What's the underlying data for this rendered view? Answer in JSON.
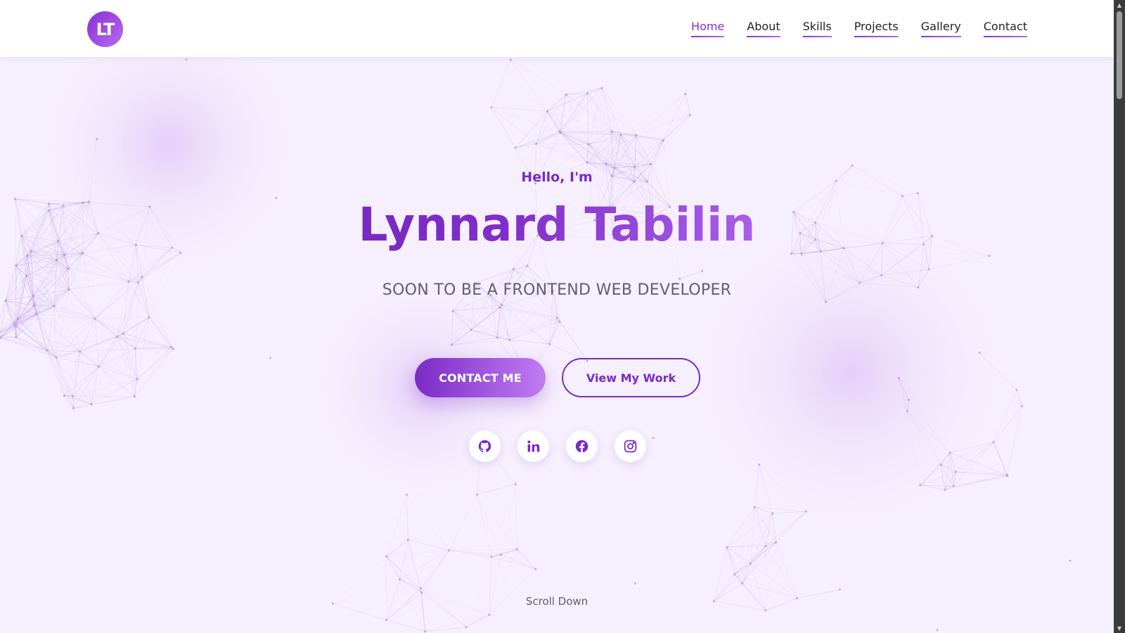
{
  "header": {
    "logo_text": "LT",
    "nav": [
      {
        "label": "Home",
        "active": true
      },
      {
        "label": "About",
        "active": false
      },
      {
        "label": "Skills",
        "active": false
      },
      {
        "label": "Projects",
        "active": false
      },
      {
        "label": "Gallery",
        "active": false
      },
      {
        "label": "Contact",
        "active": false
      }
    ]
  },
  "hero": {
    "greeting": "Hello, I'm",
    "name": "Lynnard Tabilin",
    "subtitle": "SOON TO BE A FRONTEND WEB DEVELOPER",
    "contact_button": "CONTACT ME",
    "work_button": "View My Work",
    "social_icons": [
      "github-icon",
      "linkedin-icon",
      "facebook-icon",
      "instagram-icon"
    ],
    "scroll_label": "Scroll Down"
  },
  "colors": {
    "accent": "#7a2ac8",
    "accent_light": "#c17cf2",
    "background": "#f6effd",
    "text": "#1f1f2a",
    "muted": "#5f5f6e"
  }
}
